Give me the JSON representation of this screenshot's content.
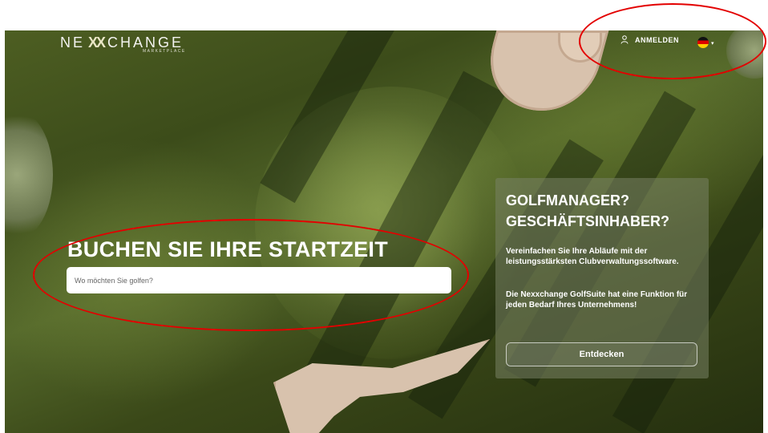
{
  "header": {
    "logo_text_left": "NE",
    "logo_text_mid": "XX",
    "logo_text_right": "CHANGE",
    "logo_subtitle": "MARKETPLACE",
    "login_label": "ANMELDEN",
    "language_flag": "german-flag-icon"
  },
  "booking": {
    "headline": "BUCHEN SIE IHRE STARTZEIT",
    "search_placeholder": "Wo möchten Sie golfen?"
  },
  "promo": {
    "title_line1": "GOLFMANAGER?",
    "title_line2": "GESCHÄFTSINHABER?",
    "paragraph1": "Vereinfachen Sie Ihre Abläufe mit der leistungsstärksten Clubverwaltungssoftware.",
    "paragraph2": "Die Nexxchange GolfSuite hat eine Funktion für jeden Bedarf Ihres Unternehmens!",
    "button_label": "Entdecken"
  },
  "annotations": {
    "ring_color": "#e30000"
  }
}
